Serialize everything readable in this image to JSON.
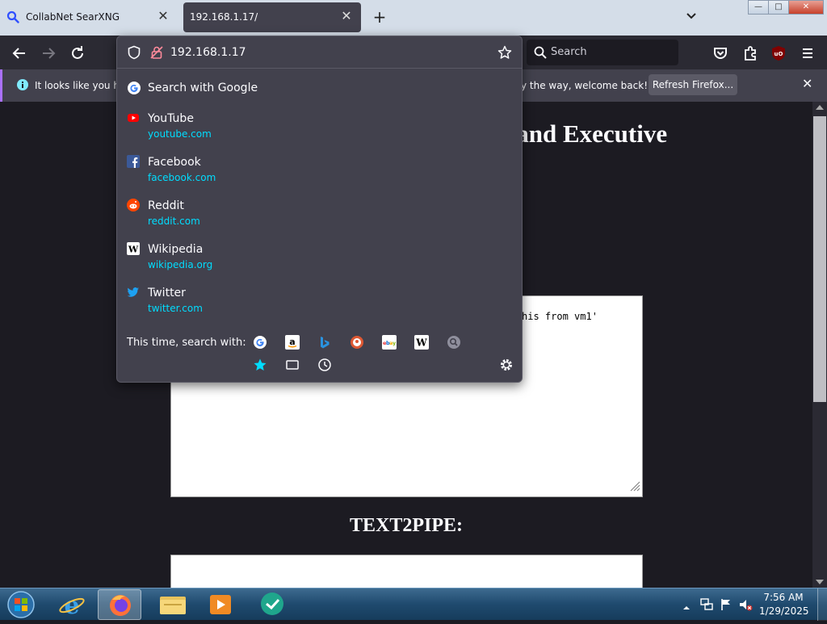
{
  "tabs": [
    {
      "title": "CollabNet SearXNG"
    },
    {
      "title": "192.168.1.17/"
    }
  ],
  "window_controls": {
    "minimize": "—",
    "maximize": "□",
    "close": "✕"
  },
  "navbar": {
    "search_placeholder": "Search"
  },
  "notification": {
    "text_start": "It looks like you ha",
    "text_end": "y the way, welcome back!",
    "refresh_label": "Refresh Firefox..."
  },
  "urlbar": {
    "value": "192.168.1.17",
    "search_with_google": "Search with Google",
    "suggestions": [
      {
        "title": "YouTube",
        "url": "youtube.com",
        "icon": "youtube-icon"
      },
      {
        "title": "Facebook",
        "url": "facebook.com",
        "icon": "facebook-icon"
      },
      {
        "title": "Reddit",
        "url": "reddit.com",
        "icon": "reddit-icon"
      },
      {
        "title": "Wikipedia",
        "url": "wikipedia.org",
        "icon": "wikipedia-icon"
      },
      {
        "title": "Twitter",
        "url": "twitter.com",
        "icon": "twitter-icon"
      }
    ],
    "oneoff_label": "This time, search with:",
    "engines": [
      "google-icon",
      "amazon-icon",
      "bing-icon",
      "duckduckgo-icon",
      "ebay-icon",
      "wikipedia-icon",
      "searxng-icon"
    ],
    "modes": [
      "bookmarks-star-icon",
      "tabs-icon",
      "history-clock-icon"
    ]
  },
  "page": {
    "heading_fragment": "nand Executive",
    "textarea_fragment": "his from vm1'",
    "section2_heading": "TEXT2PIPE:"
  },
  "taskbar": {
    "apps": [
      "internet-explorer-icon",
      "firefox-icon",
      "file-explorer-icon",
      "media-player-icon",
      "chat-app-icon"
    ],
    "active_app": "firefox-icon",
    "time": "7:56 AM",
    "date": "1/29/2025"
  },
  "colors": {
    "url_accent": "#00ddff",
    "panel_bg": "#42414d",
    "toolbar_bg": "#2b2a33",
    "notification_accent": "#ab71ff"
  }
}
